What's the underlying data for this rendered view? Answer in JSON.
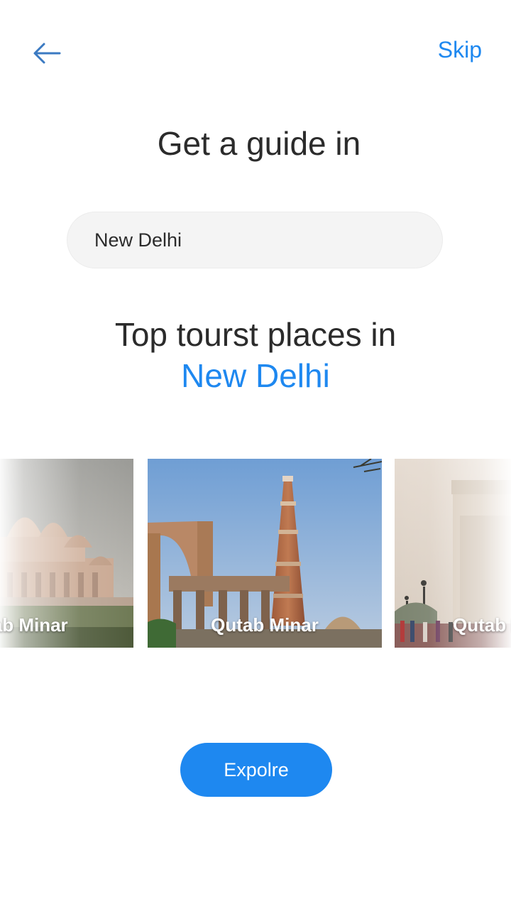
{
  "header": {
    "back_icon": "arrow-left-icon",
    "skip_label": "Skip"
  },
  "heading": "Get a guide in",
  "search": {
    "value": "New Delhi"
  },
  "places": {
    "title": "Top tourst places in",
    "city": "New Delhi",
    "cards": [
      {
        "label": "Qutab Minar",
        "visible_text": "nar"
      },
      {
        "label": "Qutab Minar"
      },
      {
        "label": "Qutab Minar",
        "visible_text": "Qutab"
      }
    ]
  },
  "explore_label": "Expolre",
  "colors": {
    "accent": "#1e88f0",
    "text": "#2b2b2b",
    "input_bg": "#f4f4f4"
  }
}
